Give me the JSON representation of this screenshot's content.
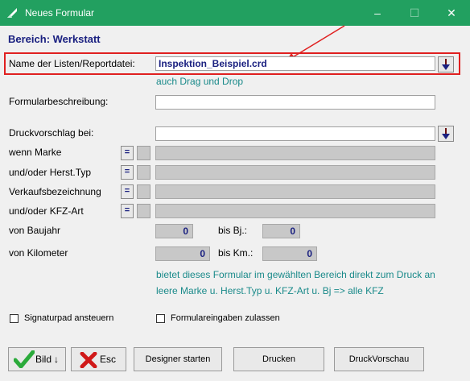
{
  "window": {
    "title": "Neues Formular",
    "minimize_glyph": "–",
    "maximize_glyph": "☐",
    "close_glyph": "✕"
  },
  "form": {
    "heading": "Bereich: Werkstatt",
    "listfile_label": "Name der Listen/Reportdatei:",
    "listfile_value": "Inspektion_Beispiel.crd",
    "dragdrop_hint": "auch Drag und Drop",
    "description_label": "Formularbeschreibung:",
    "description_value": "",
    "preview_label": "Druckvorschlag bei:",
    "preview_value": "",
    "marke_label": "wenn Marke",
    "herst_label": "und/oder Herst.Typ",
    "verkauf_label": "Verkaufsbezeichnung",
    "kfzart_label": "und/oder KFZ-Art",
    "eq_symbol": "=",
    "baujahr_label": "von Baujahr",
    "baujahr_value": "0",
    "bis_bj_label": "bis Bj.:",
    "bis_bj_value": "0",
    "km_label": "von Kilometer",
    "km_value": "0",
    "bis_km_label": "bis Km.:",
    "bis_km_value": "0",
    "info_line1": "bietet dieses Formular im gewählten Bereich direkt zum Druck an",
    "info_line2": "leere Marke u. Herst.Typ u. KFZ-Art u. Bj => alle KFZ",
    "signaturpad_label": "Signaturpad ansteuern",
    "signaturpad_checked": false,
    "formulareingaben_label": "Formulareingaben zulassen",
    "formulareingaben_checked": false
  },
  "buttons": {
    "bild": "Bild",
    "bild_arrow": "↓",
    "esc": "Esc",
    "designer": "Designer starten",
    "drucken": "Drucken",
    "druckvorschau": "DruckVorschau"
  },
  "colors": {
    "titlebar": "#22a060",
    "heading": "#1a2080",
    "hint": "#1a8a8a",
    "highlight_box": "#e02020"
  }
}
